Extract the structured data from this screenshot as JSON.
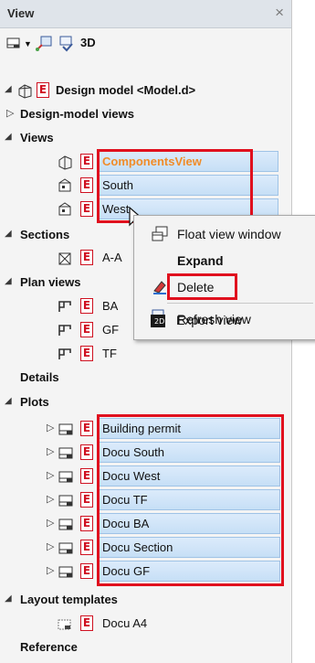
{
  "panel": {
    "title": "View",
    "close_glyph": "×"
  },
  "toolbar": {
    "mode_label": "3D"
  },
  "tree": {
    "root_label": "Design model <Model.d>",
    "design_model_views": "Design-model views",
    "views": {
      "label": "Views",
      "items": [
        "ComponentsView",
        "South",
        "West"
      ]
    },
    "sections": {
      "label": "Sections",
      "items": [
        "A-A"
      ]
    },
    "plan_views": {
      "label": "Plan views",
      "items": [
        "BA",
        "GF",
        "TF"
      ]
    },
    "details": "Details",
    "plots": {
      "label": "Plots",
      "items": [
        "Building permit",
        "Docu South",
        "Docu West",
        "Docu TF",
        "Docu BA",
        "Docu Section",
        "Docu GF"
      ]
    },
    "layout_templates": {
      "label": "Layout templates",
      "items": [
        "Docu A4"
      ]
    },
    "reference": "Reference"
  },
  "context_menu": {
    "items": [
      "Float view window",
      "Expand",
      "Delete",
      "Refresh view",
      "Export view"
    ]
  },
  "colors": {
    "highlight_red": "#e0101e",
    "e_icon_red": "#cf1020",
    "orange_text": "#f08c28"
  },
  "e_letter": "E"
}
